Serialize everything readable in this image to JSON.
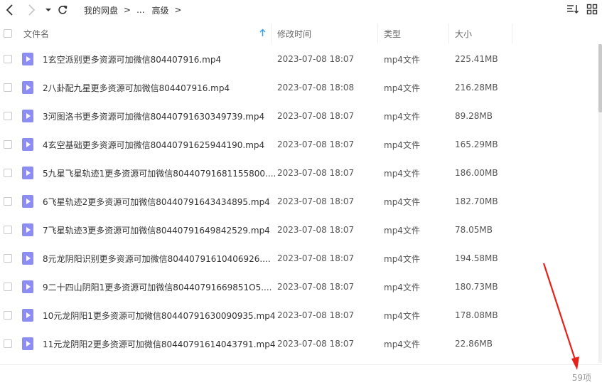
{
  "toolbar": {
    "breadcrumb": [
      "我的网盘",
      "...",
      "高级"
    ]
  },
  "columns": {
    "name": "文件名",
    "modified": "修改时间",
    "type": "类型",
    "size": "大小"
  },
  "files": [
    {
      "name": "1玄空派别更多资源可加微信804407916.mp4",
      "modified": "2023-07-08 18:07",
      "type": "mp4文件",
      "size": "225.41MB"
    },
    {
      "name": "2八卦配九星更多资源可加微信804407916.mp4",
      "modified": "2023-07-08 18:08",
      "type": "mp4文件",
      "size": "216.28MB"
    },
    {
      "name": "3河图洛书更多资源可加微信80440791630349739.mp4",
      "modified": "2023-07-08 18:07",
      "type": "mp4文件",
      "size": "89.28MB"
    },
    {
      "name": "4玄空基础更多资源可加微信80440791625944190.mp4",
      "modified": "2023-07-08 18:07",
      "type": "mp4文件",
      "size": "165.29MB"
    },
    {
      "name": "5九星飞星轨迹1更多资源可加微信80440791681155800....",
      "modified": "2023-07-08 18:07",
      "type": "mp4文件",
      "size": "186.00MB"
    },
    {
      "name": "6飞星轨迹2更多资源可加微信80440791643434895.mp4",
      "modified": "2023-07-08 18:07",
      "type": "mp4文件",
      "size": "182.70MB"
    },
    {
      "name": "7飞星轨迹3更多资源可加微信80440791649842529.mp4",
      "modified": "2023-07-08 18:07",
      "type": "mp4文件",
      "size": "78.05MB"
    },
    {
      "name": "8元龙阴阳识别更多资源可加微信80440791610406926....",
      "modified": "2023-07-08 18:07",
      "type": "mp4文件",
      "size": "194.58MB"
    },
    {
      "name": "9二十四山阴阳1更多资源可加微信80440791669851O5....",
      "modified": "2023-07-08 18:07",
      "type": "mp4文件",
      "size": "180.73MB"
    },
    {
      "name": "10元龙阴阳1更多资源可加微信80440791630090935.mp4",
      "modified": "2023-07-08 18:07",
      "type": "mp4文件",
      "size": "178.08MB"
    },
    {
      "name": "11元龙阴阳2更多资源可加微信80440791614043791.mp4",
      "modified": "2023-07-08 18:07",
      "type": "mp4文件",
      "size": "22.86MB"
    }
  ],
  "footer": {
    "count": "59项"
  },
  "colors": {
    "file_icon": "#8c8cf2",
    "sort_arrow": "#3aa0f3",
    "annotation_arrow": "#e8201a"
  },
  "icons": [
    "back-arrow-icon",
    "forward-arrow-icon",
    "dropdown-caret-icon",
    "refresh-icon",
    "sort-icon",
    "grid-view-icon"
  ]
}
